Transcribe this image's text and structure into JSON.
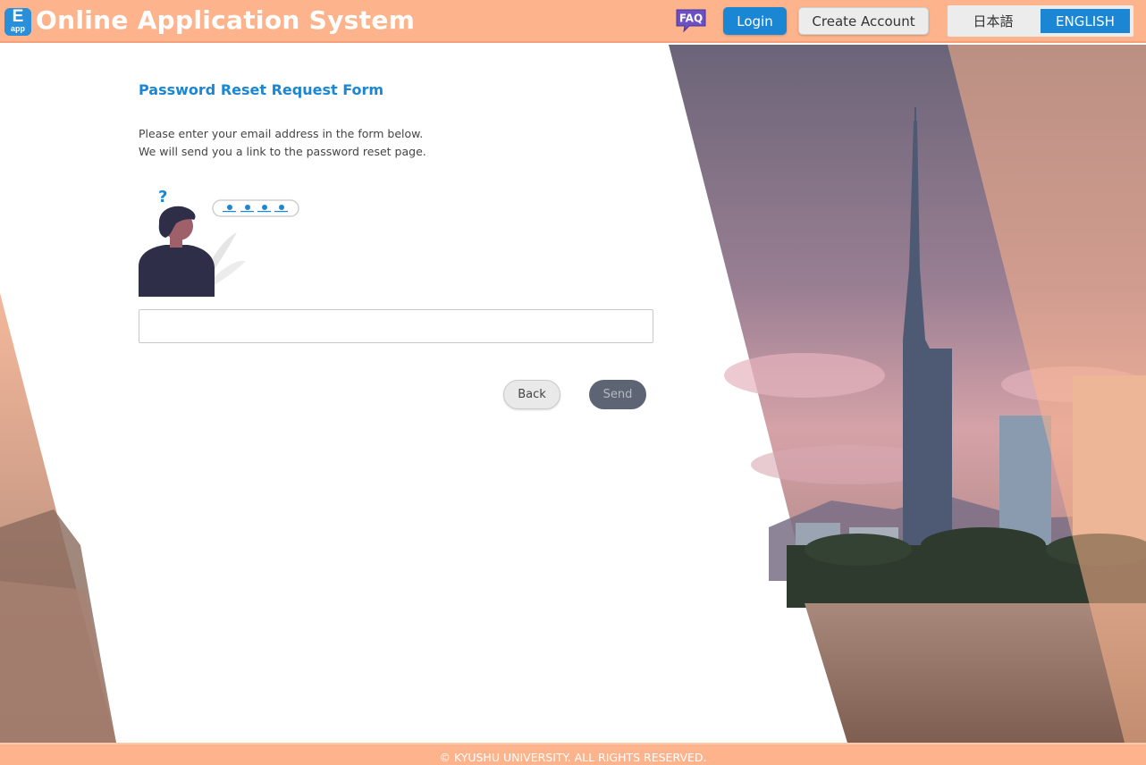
{
  "header": {
    "logo_letter": "E",
    "logo_sub": "app",
    "title": "Online Application System",
    "faq_label": "FAQ",
    "login_label": "Login",
    "create_account_label": "Create Account",
    "lang_ja_label": "日本語",
    "lang_en_label": "ENGLISH"
  },
  "form": {
    "title": "Password Reset Request Form",
    "instruction_line1": "Please enter your email address in the form below.",
    "instruction_line2": "We will send you a link to the password reset page.",
    "email_value": "",
    "back_label": "Back",
    "send_label": "Send"
  },
  "footer": {
    "copyright": "© KYUSHU UNIVERSITY. ALL RIGHTS RESERVED."
  },
  "colors": {
    "header_bg": "#fdb48c",
    "accent_blue": "#1b86d3",
    "send_bg": "#5d6473",
    "faq_purple": "#6b4fc3"
  },
  "icons": {
    "logo": "e-app-logo-icon",
    "faq": "faq-bubble-icon",
    "illustration": "person-password-illustration"
  }
}
